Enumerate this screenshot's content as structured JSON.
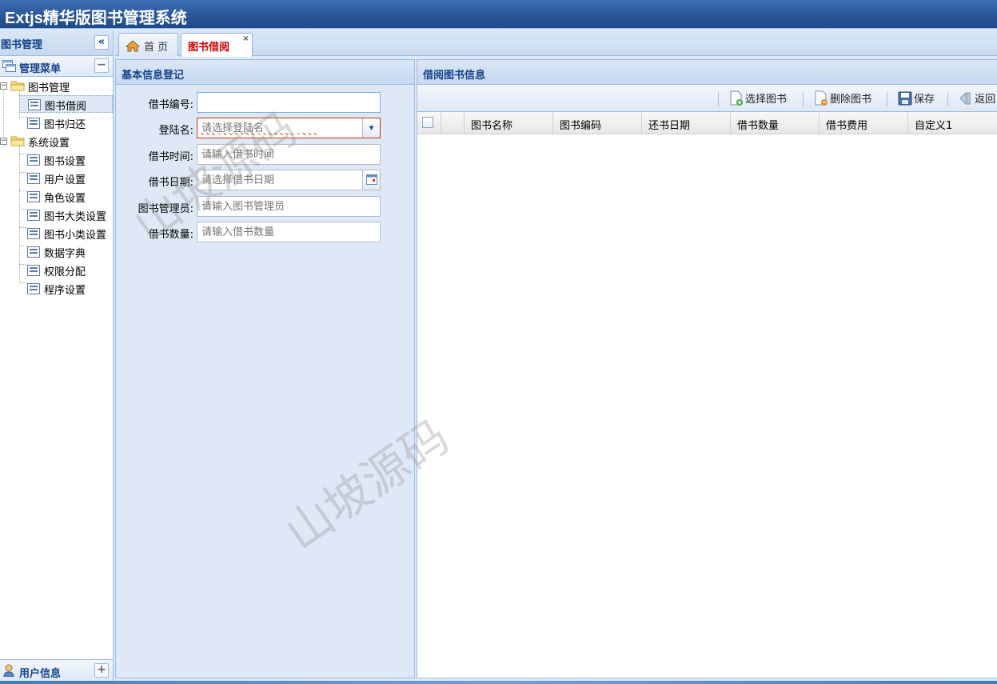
{
  "app": {
    "title": "Extjs精华版图书管理系统"
  },
  "nav": {
    "header": "图书管理",
    "collapse_glyph": "«",
    "menu_header": "管理菜单",
    "menu_toggle": "−",
    "tree": [
      {
        "label": "图书管理",
        "type": "folder",
        "expander": "−"
      },
      {
        "label": "图书借阅",
        "type": "leaf",
        "selected": true
      },
      {
        "label": "图书归还",
        "type": "leaf"
      },
      {
        "label": "系统设置",
        "type": "folder",
        "expander": "−"
      },
      {
        "label": "图书设置",
        "type": "leaf"
      },
      {
        "label": "用户设置",
        "type": "leaf"
      },
      {
        "label": "角色设置",
        "type": "leaf"
      },
      {
        "label": "图书大类设置",
        "type": "leaf"
      },
      {
        "label": "图书小类设置",
        "type": "leaf"
      },
      {
        "label": "数据字典",
        "type": "leaf"
      },
      {
        "label": "权限分配",
        "type": "leaf"
      },
      {
        "label": "程序设置",
        "type": "leaf"
      }
    ],
    "footer": "用户信息",
    "footer_toggle": "+"
  },
  "tabs": [
    {
      "label": "首 页",
      "icon": "home-icon",
      "active": false
    },
    {
      "label": "图书借阅",
      "active": true,
      "close": "×"
    }
  ],
  "form": {
    "title": "基本信息登记",
    "fields": [
      {
        "label": "借书编号:",
        "value": "",
        "placeholder": ""
      },
      {
        "label": "登陆名:",
        "value": "",
        "placeholder": "请选择登陆名",
        "trigger": "▾",
        "invalid": true
      },
      {
        "label": "借书时间:",
        "value": "",
        "placeholder": "请输入借书时间"
      },
      {
        "label": "借书日期:",
        "value": "",
        "placeholder": "请选择借书日期",
        "trigger": "calendar-icon"
      },
      {
        "label": "图书管理员:",
        "value": "",
        "placeholder": "请输入图书管理员"
      },
      {
        "label": "借书数量:",
        "value": "",
        "placeholder": "请输入借书数量"
      }
    ]
  },
  "grid": {
    "title": "借阅图书信息",
    "toolbar": [
      {
        "label": "选择图书",
        "icon": "add-document-icon"
      },
      {
        "label": "删除图书",
        "icon": "delete-document-icon"
      },
      {
        "label": "保存",
        "icon": "save-icon"
      },
      {
        "label": "返回",
        "icon": "back-icon"
      }
    ],
    "columns": [
      "图书名称",
      "图书编码",
      "还书日期",
      "借书数量",
      "借书费用",
      "自定义1"
    ]
  },
  "watermark": {
    "text": "山坡源码"
  },
  "colors": {
    "accent": "#15428b",
    "border": "#99bbe8",
    "tab_active_text": "#cc0000",
    "titlebar": "#2a5596"
  }
}
